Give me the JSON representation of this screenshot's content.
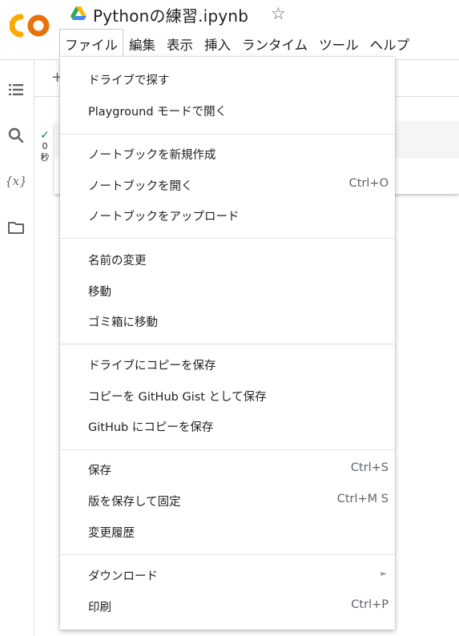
{
  "header": {
    "title": "Pythonの練習.ipynb",
    "logo_text": "CO"
  },
  "menubar": [
    {
      "label": "ファイル",
      "active": true
    },
    {
      "label": "編集"
    },
    {
      "label": "表示"
    },
    {
      "label": "挿入"
    },
    {
      "label": "ランタイム"
    },
    {
      "label": "ツール"
    },
    {
      "label": "ヘルプ"
    }
  ],
  "toolbar": {
    "add_symbol": "+"
  },
  "cell": {
    "run_time_value": "0",
    "run_time_unit": "秒"
  },
  "file_menu": {
    "items": [
      {
        "label": "ドライブで探す",
        "shortcut": ""
      },
      {
        "label": "Playground モードで開く",
        "shortcut": ""
      },
      {
        "label": "ノートブックを新規作成",
        "shortcut": ""
      },
      {
        "label": "ノートブックを開く",
        "shortcut": "Ctrl+O"
      },
      {
        "label": "ノートブックをアップロード",
        "shortcut": ""
      },
      {
        "label": "名前の変更",
        "shortcut": ""
      },
      {
        "label": "移動",
        "shortcut": ""
      },
      {
        "label": "ゴミ箱に移動",
        "shortcut": ""
      },
      {
        "label": "ドライブにコピーを保存",
        "shortcut": ""
      },
      {
        "label": "コピーを GitHub Gist として保存",
        "shortcut": ""
      },
      {
        "label": "GitHub にコピーを保存",
        "shortcut": ""
      },
      {
        "label": "保存",
        "shortcut": "Ctrl+S"
      },
      {
        "label": "版を保存して固定",
        "shortcut": "Ctrl+M S"
      },
      {
        "label": "変更履歴",
        "shortcut": ""
      },
      {
        "label": "ダウンロード",
        "shortcut": "",
        "submenu": "►"
      },
      {
        "label": "印刷",
        "shortcut": "Ctrl+P"
      }
    ]
  },
  "rail_icons": [
    "table-of-contents-icon",
    "search-icon",
    "variables-icon",
    "folder-icon"
  ],
  "colors": {
    "logo_orange": "#F9AB00",
    "logo_orange_dark": "#E8710A",
    "check_green": "#188038",
    "divider": "#e0e0e0"
  }
}
